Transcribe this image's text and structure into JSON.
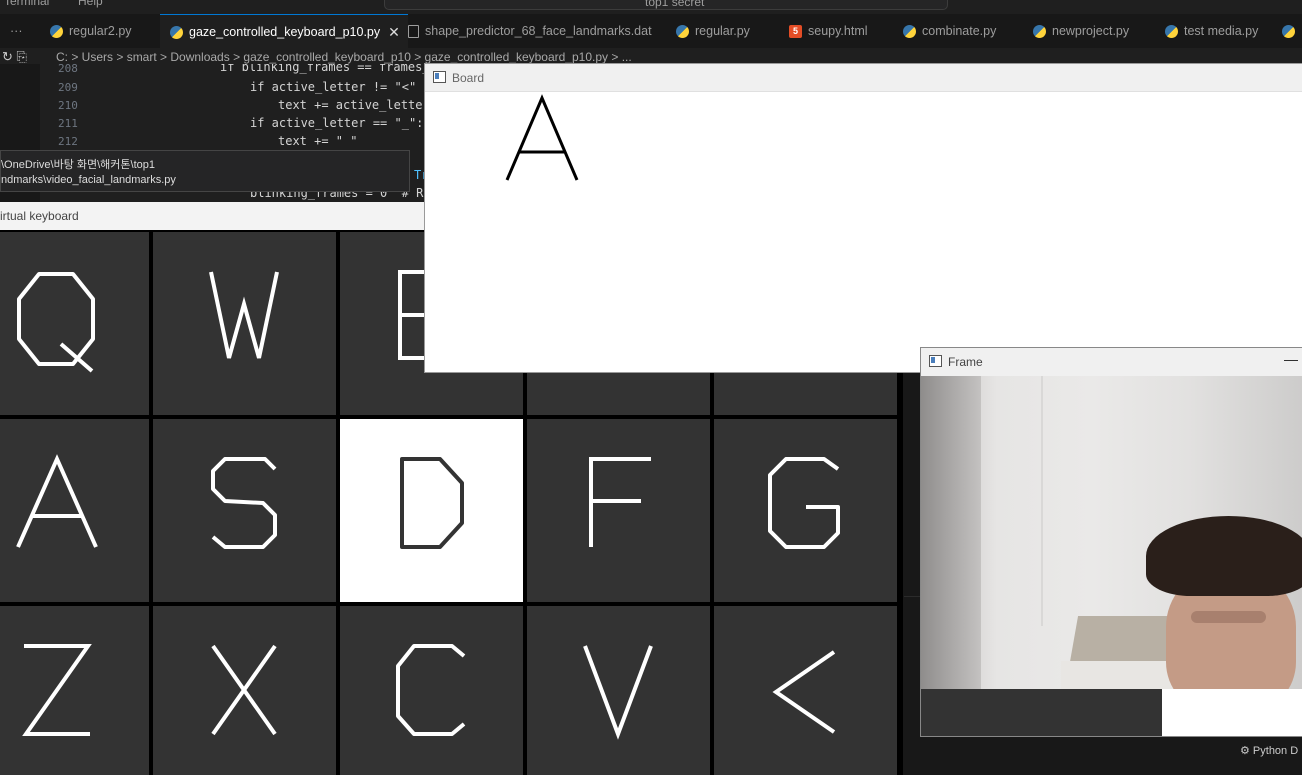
{
  "menu": {
    "items": [
      "Terminal",
      "Help"
    ],
    "command_center": "top1 secret"
  },
  "editor_tabs": [
    {
      "label": "regular2.py",
      "icon": "python-icon"
    },
    {
      "label": "gaze_controlled_keyboard_p10.py",
      "icon": "python-icon",
      "active": true
    },
    {
      "label": "shape_predictor_68_face_landmarks.dat",
      "icon": "file-icon"
    },
    {
      "label": "regular.py",
      "icon": "python-icon"
    },
    {
      "label": "seupy.html",
      "icon": "html-icon"
    },
    {
      "label": "combinate.py",
      "icon": "python-icon"
    },
    {
      "label": "newproject.py",
      "icon": "python-icon"
    },
    {
      "label": "test media.py",
      "icon": "python-icon"
    }
  ],
  "more_tabs": "···",
  "close_glyph": "✕",
  "breadcrumb": "C: > Users > smart > Downloads > gaze_controlled_keyboard_p10 > gaze_controlled_keyboard_p10.py > ...",
  "code": {
    "lines": [
      {
        "num": "208",
        "text": "if blinking_frames == frames_"
      },
      {
        "num": "209",
        "text": "if active_letter != \"<\" a"
      },
      {
        "num": "210",
        "text": "text += active_letter"
      },
      {
        "num": "211",
        "text": "if active_letter == \"_\":"
      },
      {
        "num": "212",
        "text": "text += \" \""
      },
      {
        "num": "215",
        "text": "blinking_frames = 0  # Re"
      }
    ],
    "partial_right": "Tr"
  },
  "tooltip": {
    "line1": "\\OneDrive\\바탕 화면\\해커톤\\top1",
    "line2": "ndmarks\\video_facial_landmarks.py"
  },
  "virtual_keyboard": {
    "title": "irtual keyboard",
    "rows": [
      [
        "Q",
        "W",
        "E",
        "R",
        "T"
      ],
      [
        "A",
        "S",
        "D",
        "F",
        "G"
      ],
      [
        "Z",
        "X",
        "C",
        "V",
        "<"
      ]
    ],
    "active_key": "D"
  },
  "board": {
    "title": "Board",
    "text": "A"
  },
  "frame": {
    "title": "Frame",
    "minimize": "—"
  },
  "status": {
    "interpreter": "Python D"
  }
}
